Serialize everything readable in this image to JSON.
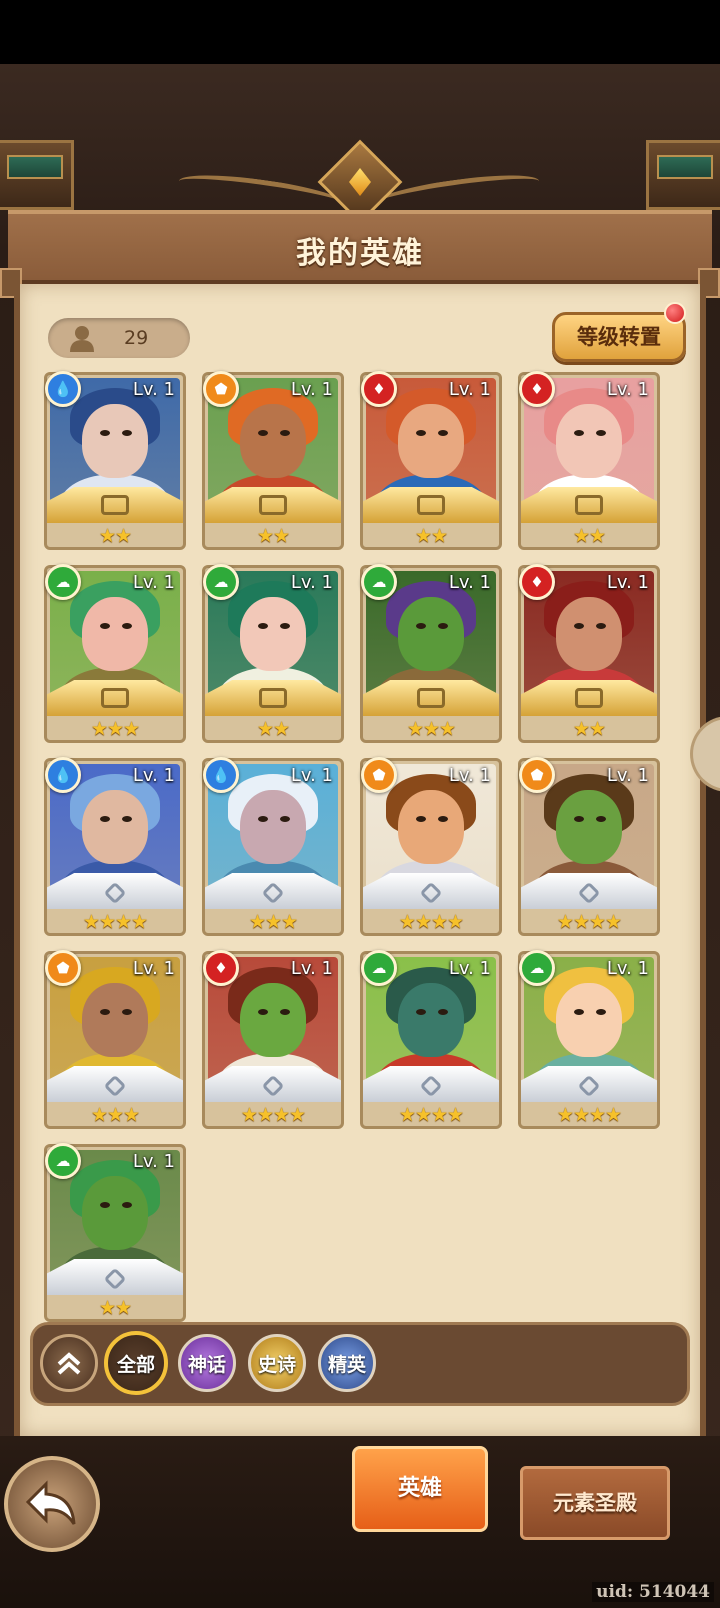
{
  "header": {
    "title": "我的英雄"
  },
  "hero_count": {
    "value": "29"
  },
  "reset_button": {
    "label": "等级转置",
    "has_notification": true
  },
  "heroes": [
    {
      "level": "Lv. 1",
      "element": "water",
      "stars": "★★",
      "frame": "gold",
      "skin": "#e8c8b8",
      "hair": "#2a4b8a",
      "bg": "#3f6aa8",
      "body": "#dfe6f2"
    },
    {
      "level": "Lv. 1",
      "element": "earth",
      "stars": "★★",
      "frame": "gold",
      "skin": "#b8744a",
      "hair": "#e06a24",
      "bg": "#6aa050",
      "body": "#c84a2a"
    },
    {
      "level": "Lv. 1",
      "element": "fire",
      "stars": "★★",
      "frame": "gold",
      "skin": "#e8a880",
      "hair": "#d45a2a",
      "bg": "#c85a3a",
      "body": "#2a6ab8"
    },
    {
      "level": "Lv. 1",
      "element": "fire",
      "stars": "★★",
      "frame": "gold",
      "skin": "#f2c6b6",
      "hair": "#e88a88",
      "bg": "#e8a0a0",
      "body": "#ffffff"
    },
    {
      "level": "Lv. 1",
      "element": "wind",
      "stars": "★★★",
      "frame": "gold",
      "skin": "#f0b8a8",
      "hair": "#3aa060",
      "bg": "#7ab04a",
      "body": "#8a7a3a"
    },
    {
      "level": "Lv. 1",
      "element": "wind",
      "stars": "★★",
      "frame": "gold",
      "skin": "#f2c8b8",
      "hair": "#1e7a5a",
      "bg": "#2a7a5a",
      "body": "#f0f0e0"
    },
    {
      "level": "Lv. 1",
      "element": "wind",
      "stars": "★★★",
      "frame": "gold",
      "skin": "#5a9a3a",
      "hair": "#5a3a8a",
      "bg": "#3a6a2a",
      "body": "#8a6a3a"
    },
    {
      "level": "Lv. 1",
      "element": "fire",
      "stars": "★★",
      "frame": "gold",
      "skin": "#d09070",
      "hair": "#8a1e1a",
      "bg": "#8a2a22",
      "body": "#c83a3a"
    },
    {
      "level": "Lv. 1",
      "element": "water",
      "stars": "★★★★",
      "frame": "silver",
      "skin": "#e0b8a0",
      "hair": "#7aa8e0",
      "bg": "#4a6ac8",
      "body": "#3a5aa8"
    },
    {
      "level": "Lv. 1",
      "element": "water",
      "stars": "★★★",
      "frame": "silver",
      "skin": "#c8a8b0",
      "hair": "#e8f0f8",
      "bg": "#5ab0d8",
      "body": "#4a8ab0"
    },
    {
      "level": "Lv. 1",
      "element": "earth",
      "stars": "★★★★",
      "frame": "silver",
      "skin": "#e8a878",
      "hair": "#8a4a1a",
      "bg": "#f0e8d8",
      "body": "#d8d8e0"
    },
    {
      "level": "Lv. 1",
      "element": "earth",
      "stars": "★★★★",
      "frame": "silver",
      "skin": "#6aa040",
      "hair": "#5a3a1a",
      "bg": "#c8a888",
      "body": "#8a5a3a"
    },
    {
      "level": "Lv. 1",
      "element": "earth",
      "stars": "★★★",
      "frame": "silver",
      "skin": "#b07a5a",
      "hair": "#d8a820",
      "bg": "#c8a040",
      "body": "#e0b830"
    },
    {
      "level": "Lv. 1",
      "element": "fire",
      "stars": "★★★★",
      "frame": "silver",
      "skin": "#6aa840",
      "hair": "#7a2a1a",
      "bg": "#b84a3a",
      "body": "#f0e8d8"
    },
    {
      "level": "Lv. 1",
      "element": "wind",
      "stars": "★★★★",
      "frame": "silver",
      "skin": "#3a7a6a",
      "hair": "#2a5a4a",
      "bg": "#8ac04a",
      "body": "#c83a2a"
    },
    {
      "level": "Lv. 1",
      "element": "wind",
      "stars": "★★★★",
      "frame": "silver",
      "skin": "#f8d0b0",
      "hair": "#f0c040",
      "bg": "#8ab048",
      "body": "#6ab0a0"
    },
    {
      "level": "Lv. 1",
      "element": "wind",
      "stars": "★★",
      "frame": "silver",
      "skin": "#5a9a3a",
      "hair": "#3a9a4a",
      "bg": "#6a8a4a",
      "body": "#4a6a3a"
    }
  ],
  "element_colors": {
    "water": "#2e7fe0",
    "earth": "#f08a1a",
    "fire": "#d42222",
    "wind": "#2faa3a"
  },
  "filters": {
    "all": "全部",
    "myth": "神话",
    "epic": "史诗",
    "elite": "精英"
  },
  "bottom_nav": {
    "hero_tab": "英雄",
    "temple_tab": "元素圣殿"
  },
  "uid": "uid: 514044"
}
